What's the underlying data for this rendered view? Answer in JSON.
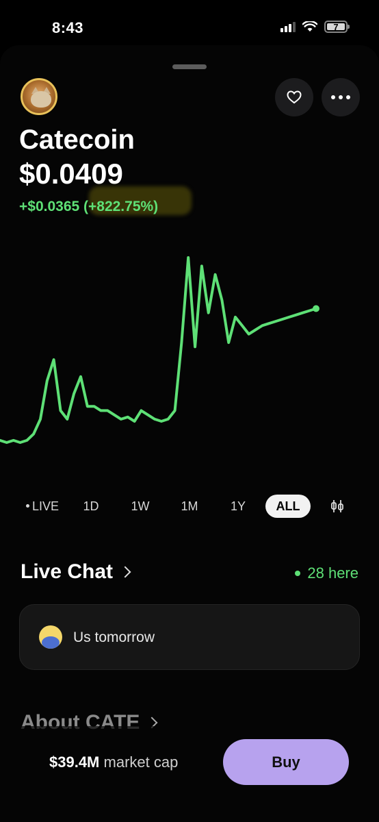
{
  "status_bar": {
    "time": "8:43",
    "battery": "7",
    "signal_bars": 3,
    "signal_total": 4
  },
  "coin": {
    "name": "Catecoin",
    "price": "$0.0409",
    "change": "+$0.0365 (+822.75%)",
    "logo_icon": "cat-coin-logo",
    "accent_color": "#5ee076"
  },
  "actions": {
    "favorite_icon": "heart-icon",
    "more_icon": "more-dots-icon"
  },
  "chart_data": {
    "type": "line",
    "title": "",
    "color": "#5ee076",
    "x": [
      0,
      1,
      2,
      3,
      4,
      5,
      6,
      7,
      8,
      9,
      10,
      11,
      12,
      13,
      14,
      15,
      16,
      17,
      18,
      19,
      20,
      21,
      22,
      23,
      24,
      25,
      26,
      27,
      28,
      29,
      30,
      31,
      32,
      33,
      34,
      35,
      36,
      37,
      38,
      39,
      40,
      41,
      42,
      43,
      44,
      45,
      46,
      47
    ],
    "values": [
      6,
      5,
      6,
      5,
      6,
      9,
      16,
      34,
      44,
      20,
      16,
      28,
      36,
      22,
      22,
      20,
      20,
      18,
      16,
      17,
      15,
      20,
      18,
      16,
      15,
      16,
      20,
      52,
      92,
      50,
      88,
      66,
      84,
      72,
      52,
      64,
      60,
      56,
      58,
      60,
      61,
      62,
      63,
      64,
      65,
      66,
      67,
      68
    ],
    "note_end_marker": true
  },
  "ranges": {
    "items": [
      {
        "label": "LIVE",
        "active": false
      },
      {
        "label": "1D",
        "active": false
      },
      {
        "label": "1W",
        "active": false
      },
      {
        "label": "1M",
        "active": false
      },
      {
        "label": "1Y",
        "active": false
      },
      {
        "label": "ALL",
        "active": true
      }
    ],
    "candle_icon": "candlestick-icon"
  },
  "live_chat": {
    "title": "Live Chat",
    "here_count": "28 here",
    "message": "Us tomorrow",
    "avatar_icon": "user-avatar"
  },
  "about": {
    "title": "About CATE"
  },
  "footer": {
    "market_cap_value": "$39.4M",
    "market_cap_label": "market cap",
    "buy_label": "Buy",
    "buy_color": "#b7a2ee"
  }
}
